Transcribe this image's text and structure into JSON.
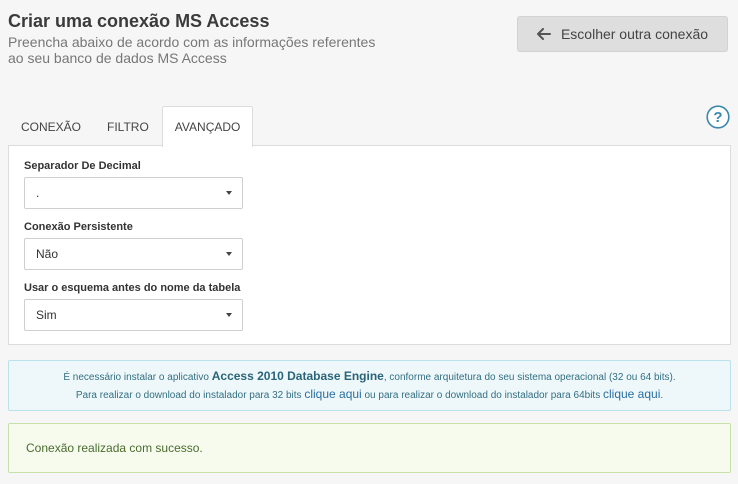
{
  "header": {
    "title": "Criar uma conexão MS Access",
    "subtitle_line1": "Preencha abaixo de acordo com as informações referentes",
    "subtitle_line2": "ao seu banco de dados MS Access",
    "back_button_label": "Escolher outra conexão",
    "back_icon": "arrow-left-icon"
  },
  "help": {
    "icon": "help-circle-icon"
  },
  "tabs": [
    {
      "label": "CONEXÃO",
      "active": false
    },
    {
      "label": "FILTRO",
      "active": false
    },
    {
      "label": "AVANÇADO",
      "active": true
    }
  ],
  "form": {
    "decimal_separator": {
      "label": "Separador De Decimal",
      "value": "."
    },
    "persistent_connection": {
      "label": "Conexão Persistente",
      "value": "Não"
    },
    "schema_before_table": {
      "label": "Usar o esquema antes do nome da tabela",
      "value": "Sim"
    }
  },
  "info": {
    "line1_prefix": "É necessário instalar o aplicativo ",
    "line1_app": "Access 2010 Database Engine",
    "line1_suffix": ", conforme arquitetura do seu sistema operacional (32 ou 64 bits).",
    "line2_part1": "Para realizar o download do instalador para 32 bits ",
    "link_32": "clique aqui",
    "line2_part2": " ou para realizar o download do instalador para 64bits ",
    "link_64": "clique aqui",
    "line2_end": "."
  },
  "status": {
    "message": "Conexão realizada com sucesso."
  },
  "colors": {
    "info_background": "#eef8fb",
    "info_border": "#b9e2ec",
    "success_background": "#f6fbee",
    "success_border": "#c7e0aa",
    "help_icon": "#3a87ad"
  }
}
